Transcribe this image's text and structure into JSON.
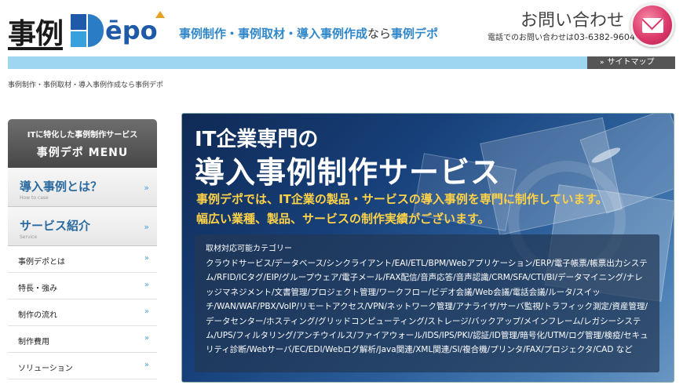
{
  "header": {
    "logo": {
      "kanji": "事例",
      "brand": "Dēpo"
    },
    "tagline": {
      "part1": "事例制作・事例取材・導入事例作成",
      "part2": "なら",
      "part3": "事例デポ"
    },
    "contact": {
      "title": "お問い合わせ",
      "phone_label": "電話でのお問い合わせは",
      "phone_number": "03-6382-9604"
    },
    "sitemap_label": "サイトマップ"
  },
  "breadcrumb": "事例制作・事例取材・導入事例作成なら事例デポ",
  "sidebar": {
    "head_sub": "ITに特化した事例制作サービス",
    "head_main": "事例デポ MENU",
    "big_items": [
      {
        "label": "導入事例とは？",
        "sub": "How to case"
      },
      {
        "label": "サービス紹介",
        "sub": "Service"
      }
    ],
    "items": [
      {
        "label": "事例デポとは"
      },
      {
        "label": "特長・強み"
      },
      {
        "label": "制作の流れ"
      },
      {
        "label": "制作費用"
      },
      {
        "label": "ソリューション"
      }
    ]
  },
  "hero": {
    "line1": "IT企業専門の",
    "line2": "導入事例制作サービス",
    "sub1": "事例デポでは、IT企業の製品・サービスの導入事例を専門に制作しています。",
    "sub2": "幅広い業種、製品、サービスの制作実績がございます。",
    "categories_title": "取材対応可能カテゴリー",
    "categories_text": "クラウドサービス/データベース/シンクライアント/EAI/ETL/BPM/Webアプリケーション/ERP/電子帳票/帳票出力システム/RFID/ICタグ/EIP/グループウェア/電子メール/FAX配信/音声応答/音声認識/CRM/SFA/CTI/BI/データマイニング/ナレッジマネジメント/文書管理/プロジェクト管理/ワークフロー/ビデオ会議/Web会議/電話会議/ルータ/スイッチ/WAN/WAF/PBX/VoIP/リモートアクセス/VPN/ネットワーク管理/アナライザ/サーバ監視/トラフィック測定/資産管理/データセンター/ホスティング/グリッドコンピューティング/ストレージ/バックアップ/メインフレーム/レガシーシステム/UPS/フィルタリング/アンチウイルス/ファイアウォール/IDS/IPS/PKI/認証/ID管理/暗号化/UTM/ログ管理/検疫/セキュリティ診断/Webサーバ/EC/EDI/Webログ解析/Java関連/XML関連/SI/複合機/プリンタ/FAX/プロジェクタ/CAD など"
  },
  "colors": {
    "accent_blue": "#2f86c9",
    "bar_blue": "#9ed6ef",
    "hero_yellow": "#ffd247",
    "mail_pink": "#dc3a6a"
  }
}
